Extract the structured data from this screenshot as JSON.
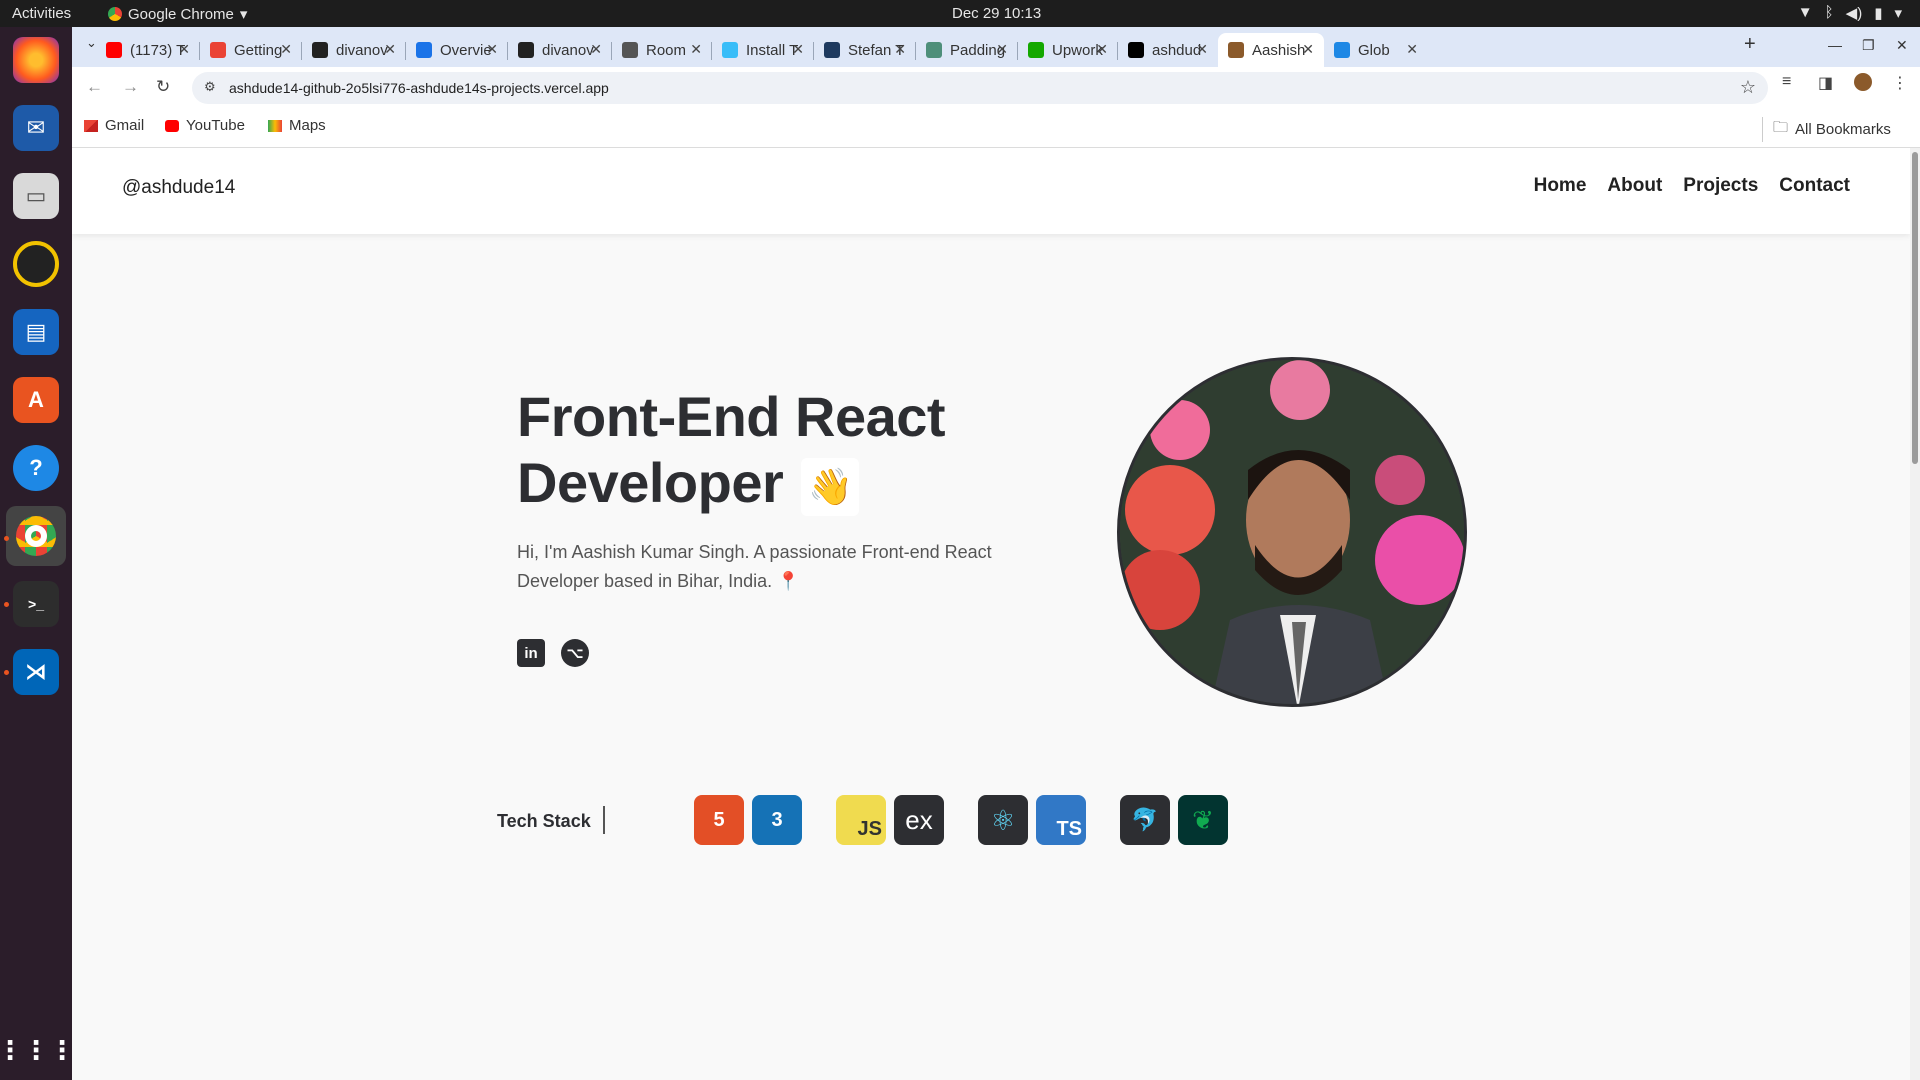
{
  "system": {
    "activities": "Activities",
    "app_name": "Google Chrome",
    "clock": "Dec 29  10:13"
  },
  "tabs": [
    {
      "title": "(1173) T",
      "color": "#ff0000"
    },
    {
      "title": "Getting",
      "color": "#ea4335"
    },
    {
      "title": "divanov",
      "color": "#222222"
    },
    {
      "title": "Overvie",
      "color": "#1a73e8"
    },
    {
      "title": "divanov",
      "color": "#222222"
    },
    {
      "title": "Room",
      "color": "#555555"
    },
    {
      "title": "Install T",
      "color": "#38bdf8"
    },
    {
      "title": "Stefan T",
      "color": "#1e3a5f"
    },
    {
      "title": "Padding",
      "color": "#4e8f7a"
    },
    {
      "title": "Upwork",
      "color": "#14a800"
    },
    {
      "title": "ashdud",
      "color": "#000000"
    },
    {
      "title": "Aashish",
      "color": "#8b5a2b"
    },
    {
      "title": "Glob",
      "color": "#1e88e5"
    }
  ],
  "browser": {
    "url": "ashdude14-github-2o5lsi776-ashdude14s-projects.vercel.app"
  },
  "bookmarks": [
    {
      "label": "Gmail"
    },
    {
      "label": "YouTube"
    },
    {
      "label": "Maps"
    }
  ],
  "all_bookmarks": "All Bookmarks",
  "site": {
    "logo": "@ashdude14",
    "menu": [
      "Home",
      "About",
      "Projects",
      "Contact"
    ],
    "hero_title_line1": "Front-End React",
    "hero_title_line2": "Developer",
    "wave": "👋",
    "hero_text": "Hi, I'm Aashish Kumar Singh. A passionate Front-end React Developer based in Bihar, India. 📍",
    "tech_label": "Tech Stack",
    "tech": [
      "HTML5",
      "CSS3",
      "JS",
      "Express",
      "React",
      "TS",
      "MySQL",
      "MongoDB"
    ]
  }
}
